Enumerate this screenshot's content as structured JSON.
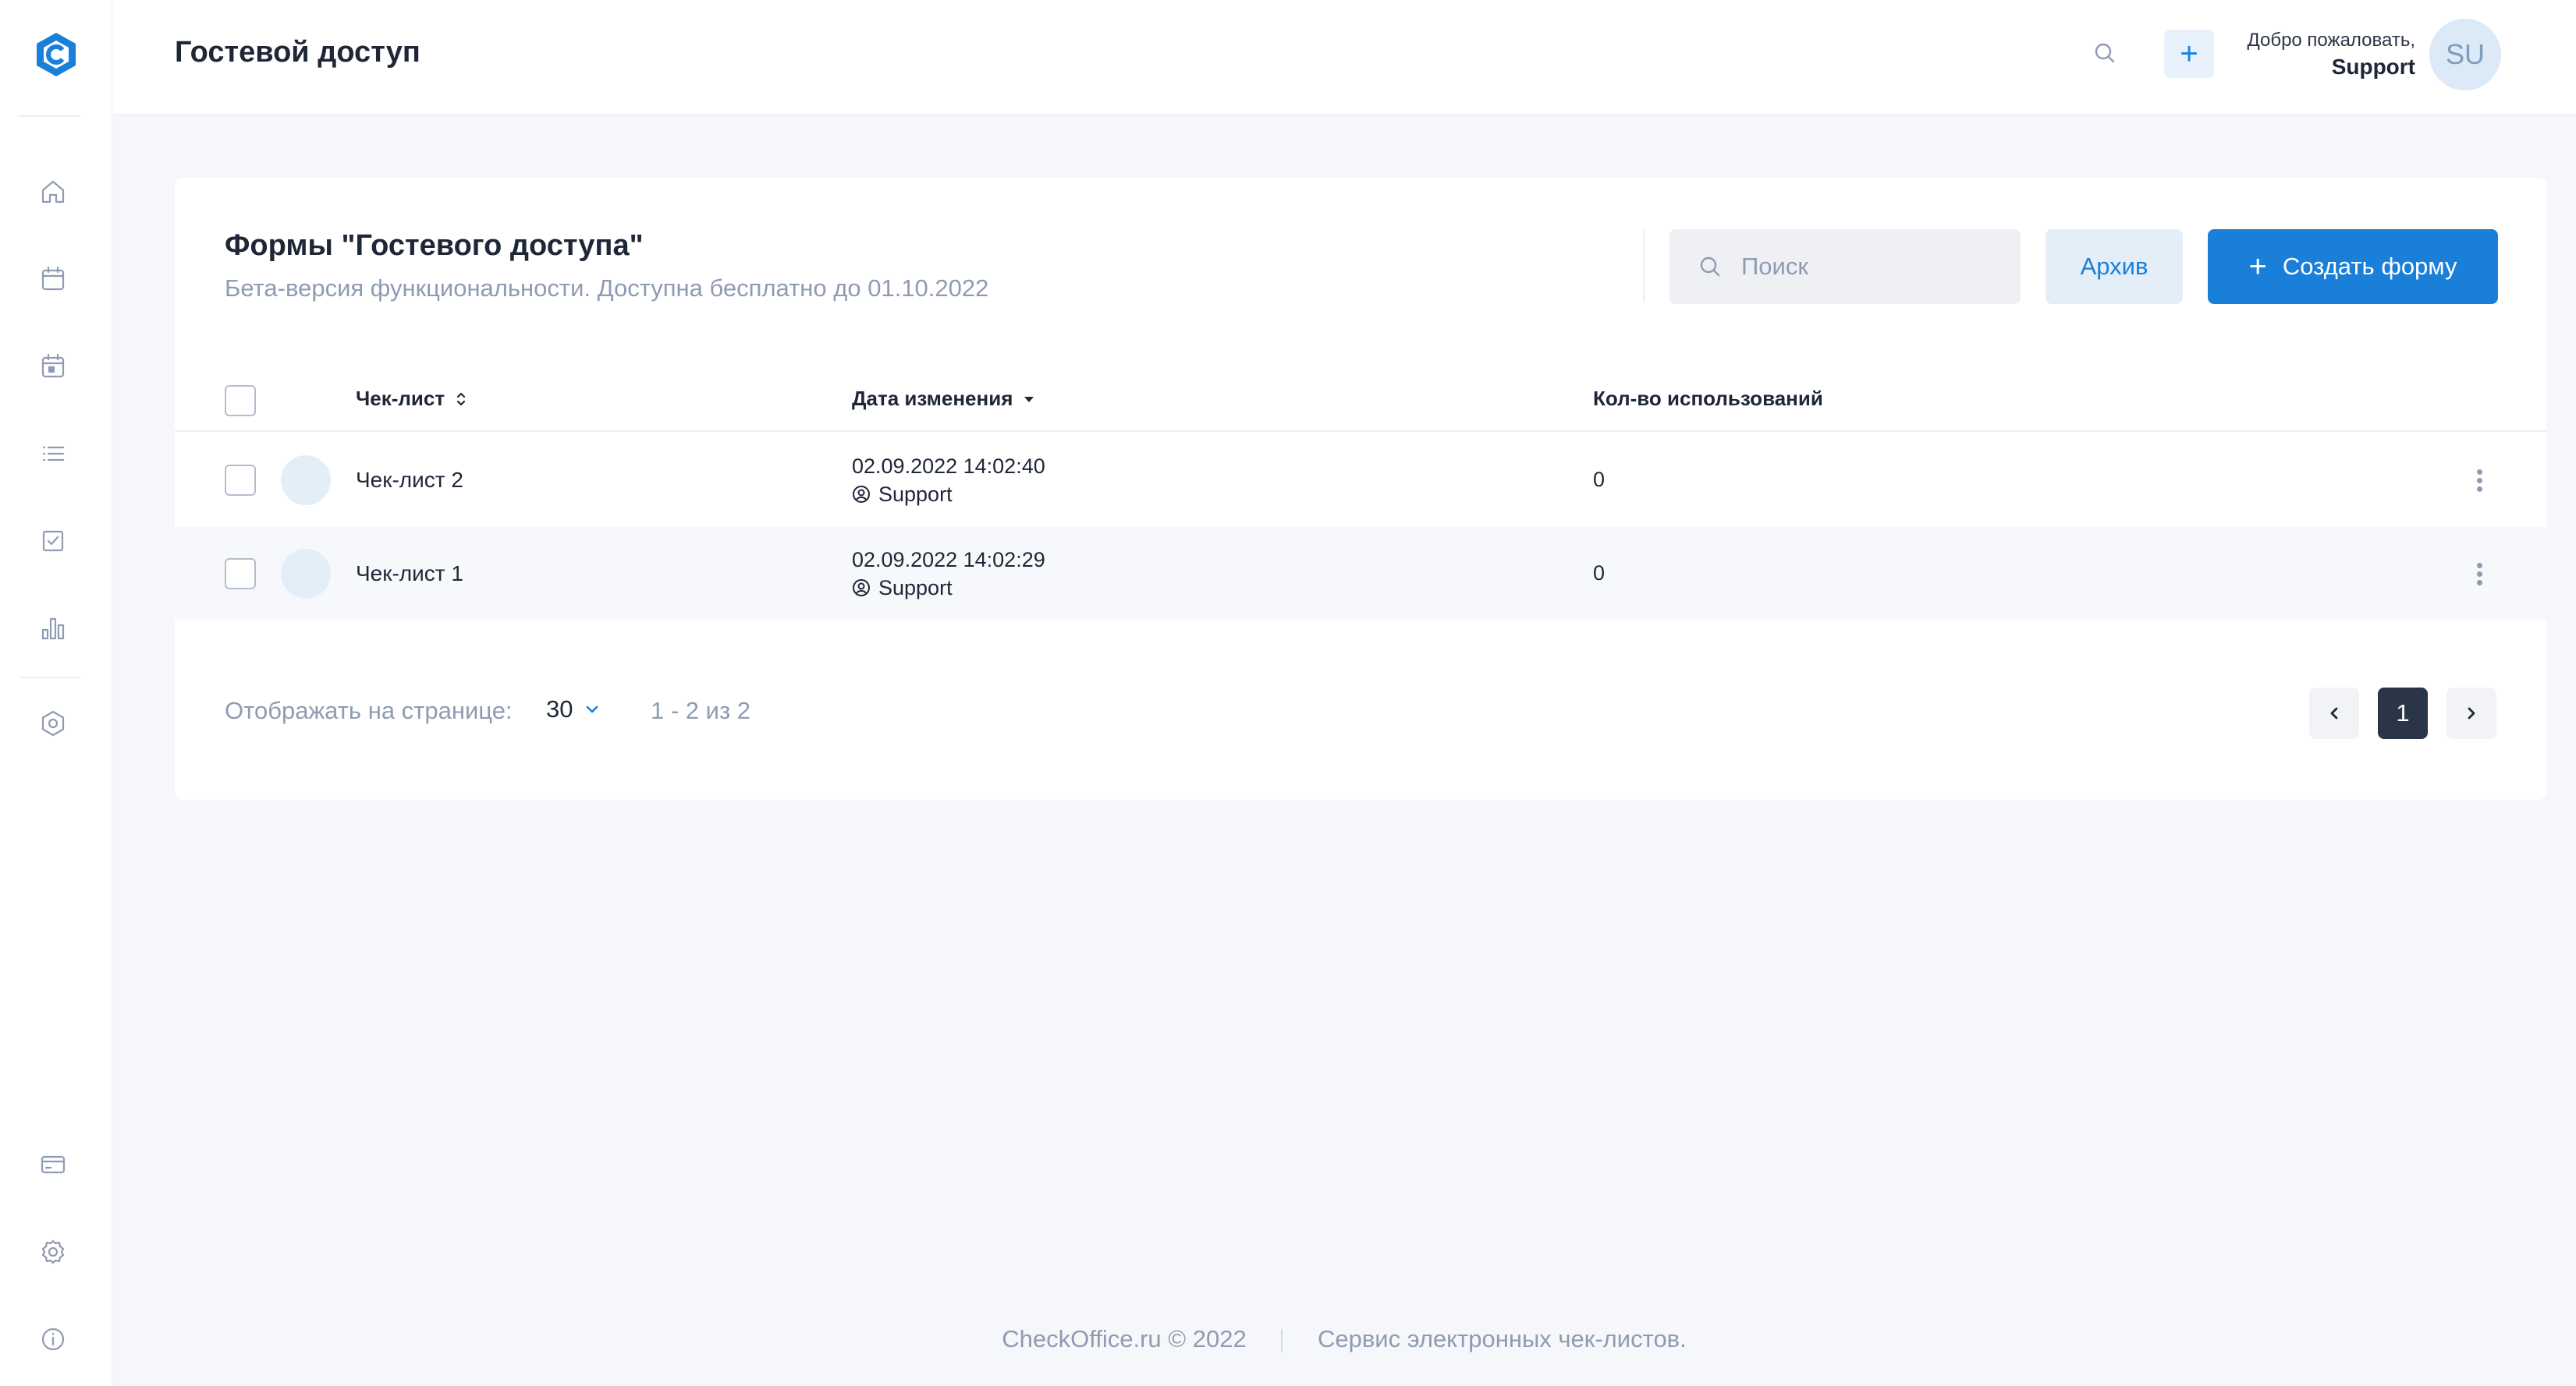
{
  "header": {
    "title": "Гостевой доступ",
    "welcome_line": "Добро пожаловать,",
    "username": "Support",
    "avatar_initials": "SU",
    "add_label": "+"
  },
  "sidebar": {
    "items": [
      {
        "name": "home-icon"
      },
      {
        "name": "calendar-icon"
      },
      {
        "name": "calendar-day-icon"
      },
      {
        "name": "list-icon"
      },
      {
        "name": "checkbox-icon"
      },
      {
        "name": "bar-chart-icon"
      },
      {
        "name": "hexagon-settings-icon"
      },
      {
        "name": "credit-card-icon"
      },
      {
        "name": "gear-icon"
      },
      {
        "name": "info-icon"
      }
    ]
  },
  "card": {
    "title": "Формы \"Гостевого доступа\"",
    "subtitle": "Бета-версия функциональности. Доступна бесплатно до 01.10.2022",
    "search_placeholder": "Поиск",
    "archive_label": "Архив",
    "create_label": "Создать форму"
  },
  "table": {
    "columns": {
      "checklist": "Чек-лист",
      "date": "Дата изменения",
      "uses": "Кол-во использований"
    },
    "rows": [
      {
        "name": "Чек-лист 2",
        "date": "02.09.2022 14:02:40",
        "user": "Support",
        "uses": "0"
      },
      {
        "name": "Чек-лист 1",
        "date": "02.09.2022 14:02:29",
        "user": "Support",
        "uses": "0"
      }
    ]
  },
  "pagination": {
    "per_page_label": "Отображать на странице:",
    "per_page_value": "30",
    "range": "1 - 2 из 2",
    "current_page": "1"
  },
  "footer": {
    "copyright": "CheckOffice.ru © 2022",
    "tagline": "Сервис электронных чек-листов."
  },
  "colors": {
    "accent": "#1a7fd8",
    "dark": "#1e2637",
    "muted": "#8f9bb3"
  }
}
